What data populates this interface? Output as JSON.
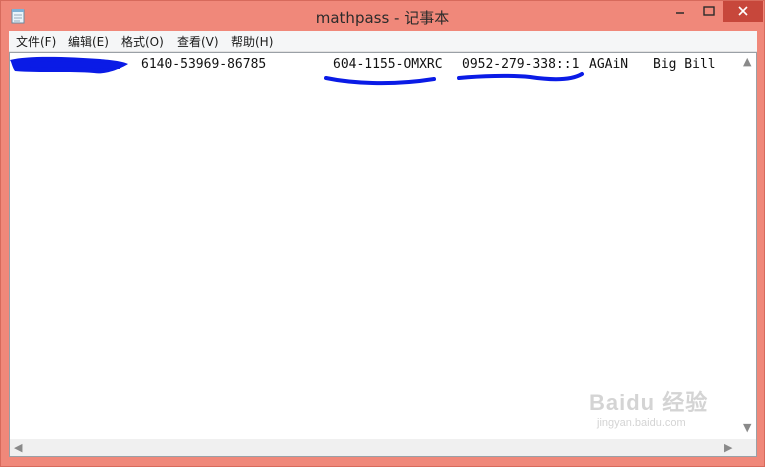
{
  "window": {
    "title": "mathpass - 记事本"
  },
  "menubar": {
    "items": [
      {
        "label": "文件(F)"
      },
      {
        "label": "编辑(E)"
      },
      {
        "label": "格式(O)"
      },
      {
        "label": "查看(V)"
      },
      {
        "label": "帮助(H)"
      }
    ]
  },
  "editor": {
    "line1_parts": [
      "6140-53969-86785",
      "604-1155-OMXRC",
      "0952-279-338::1",
      "AGAiN",
      "Big Bill"
    ]
  },
  "watermark": {
    "brand": "Baidu 经验",
    "url": "jingyan.baidu.com"
  },
  "colors": {
    "titlebar": "#f0887a",
    "close_button": "#c7473b",
    "scribble": "#0a1be6"
  }
}
